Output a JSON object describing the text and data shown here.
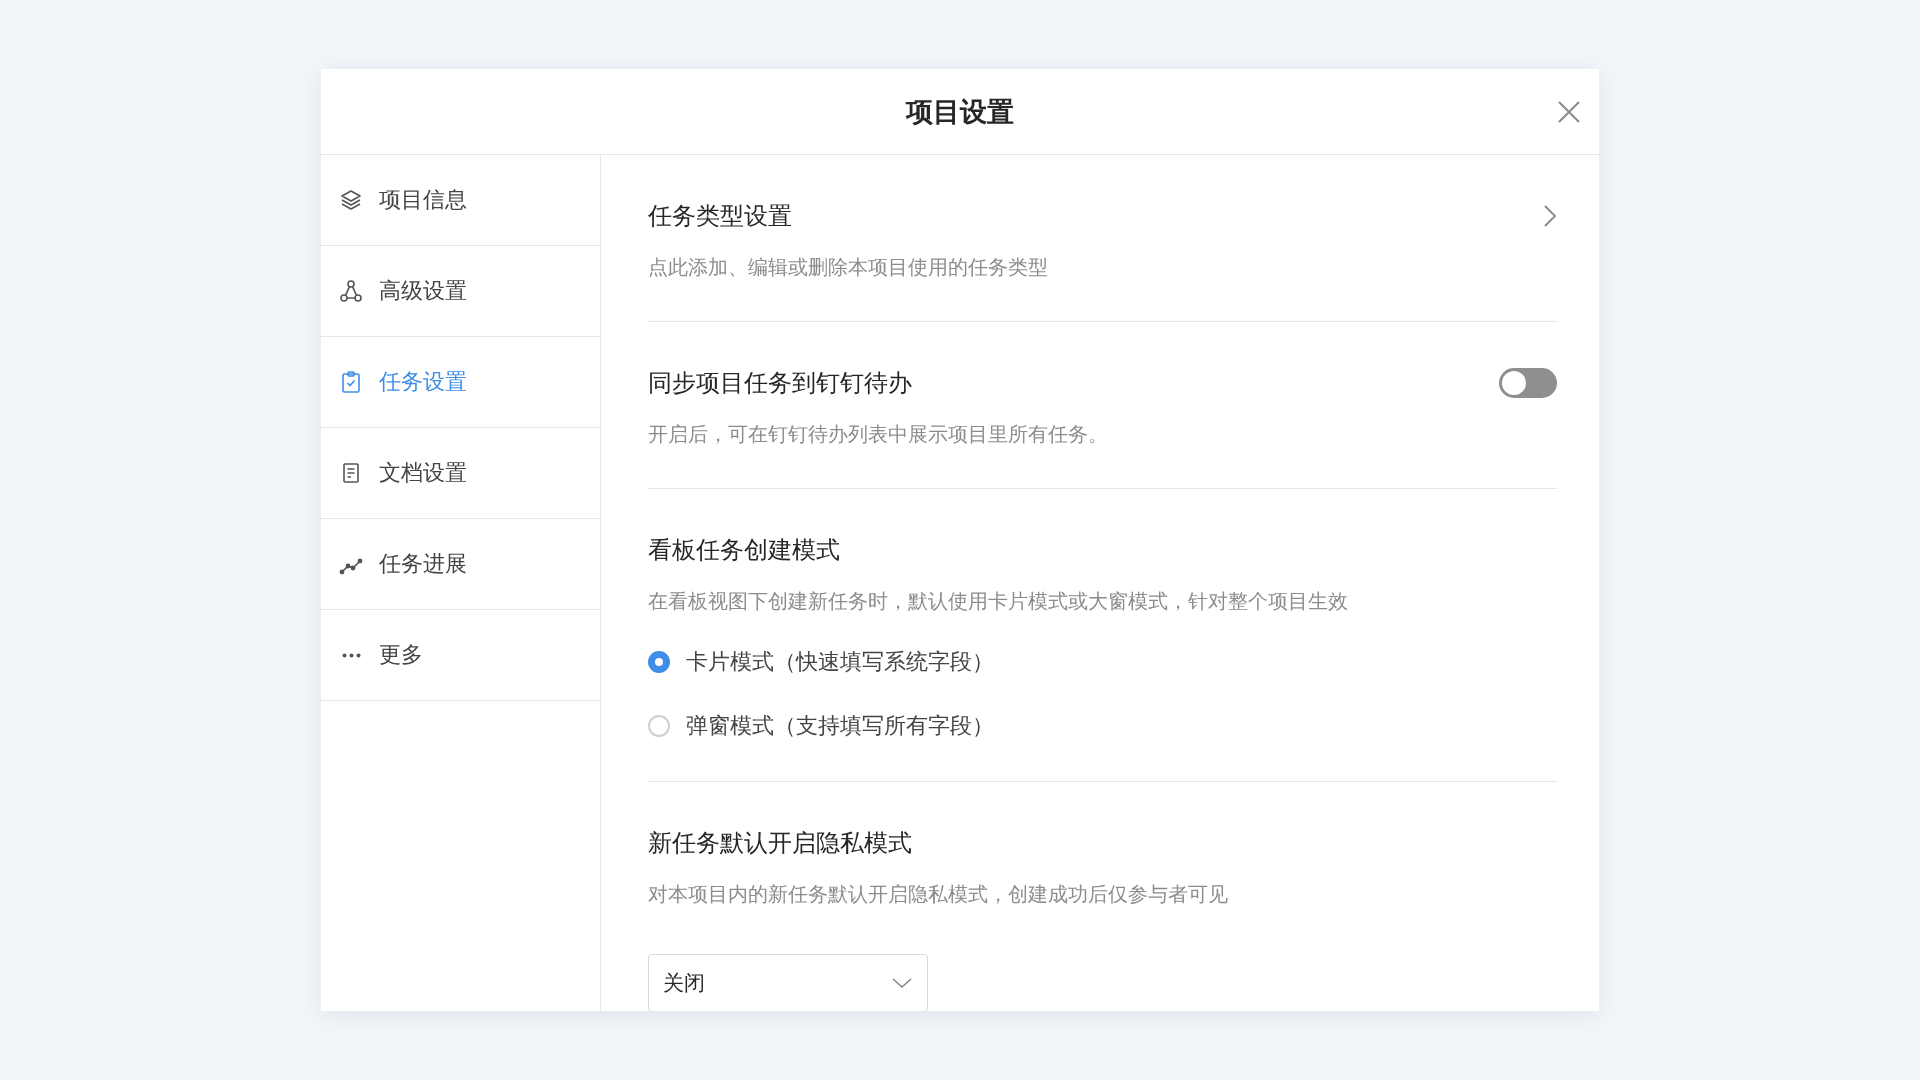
{
  "dialog": {
    "title": "项目设置"
  },
  "sidebar": {
    "items": [
      {
        "label": "项目信息",
        "selected": false
      },
      {
        "label": "高级设置",
        "selected": false
      },
      {
        "label": "任务设置",
        "selected": true
      },
      {
        "label": "文档设置",
        "selected": false
      },
      {
        "label": "任务进展",
        "selected": false
      },
      {
        "label": "更多",
        "selected": false
      }
    ]
  },
  "sections": [
    {
      "kind": "link",
      "title": "任务类型设置",
      "description": "点此添加、编辑或删除本项目使用的任务类型"
    },
    {
      "kind": "toggle",
      "title": "同步项目任务到钉钉待办",
      "description": "开启后，可在钉钉待办列表中展示项目里所有任务。",
      "on": false
    },
    {
      "kind": "radio",
      "title": "看板任务创建模式",
      "description": "在看板视图下创建新任务时，默认使用卡片模式或大窗模式，针对整个项目生效",
      "options": [
        {
          "label": "卡片模式（快速填写系统字段）",
          "selected": true
        },
        {
          "label": "弹窗模式（支持填写所有字段）",
          "selected": false
        }
      ]
    },
    {
      "kind": "select",
      "title": "新任务默认开启隐私模式",
      "description": "对本项目内的新任务默认开启隐私模式，创建成功后仅参与者可见",
      "value": "关闭"
    }
  ]
}
